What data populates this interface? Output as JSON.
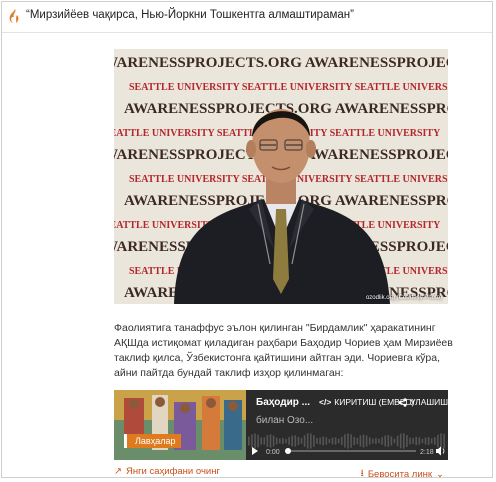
{
  "header": {
    "title": "“Мирзийёев чақирса, Нью-Йоркни Тошкентга алмаштираман”",
    "logo_icon": "rferl-flame-icon",
    "accent": "#e07a1f"
  },
  "photo": {
    "backdrop_words": [
      "AWARENESSPROJECTS.ORG",
      "SEATTLE UNIVERSITY"
    ],
    "credit": "ozodlik.org (Courtesy Photo)"
  },
  "article": {
    "paragraph": "Фаолиятига танаффус эълон қилинган \"Бирдамлик\" ҳаракатининг АҚШда истиқомат қиладиган раҳбари Баҳодир Чориев ҳам Мирзиёев таклиф қилса, Ўзбекистонга қайтишини айтган эди. Чориевга кўра, айни пайтда бундай таклиф изҳор қилинмаган:"
  },
  "player": {
    "badge": "Лавҳалар",
    "title": "Баҳодир ...",
    "subtitle": "билан Озо...",
    "embed_label": "КИРИТИШ (EMBED)",
    "share_label": "УЛАШИШ",
    "time_current": "0:00",
    "time_total": "2:18",
    "progress": 0
  },
  "footer": {
    "new_window": "Янги саҳифани очинг",
    "download": "Бевосита линк"
  }
}
